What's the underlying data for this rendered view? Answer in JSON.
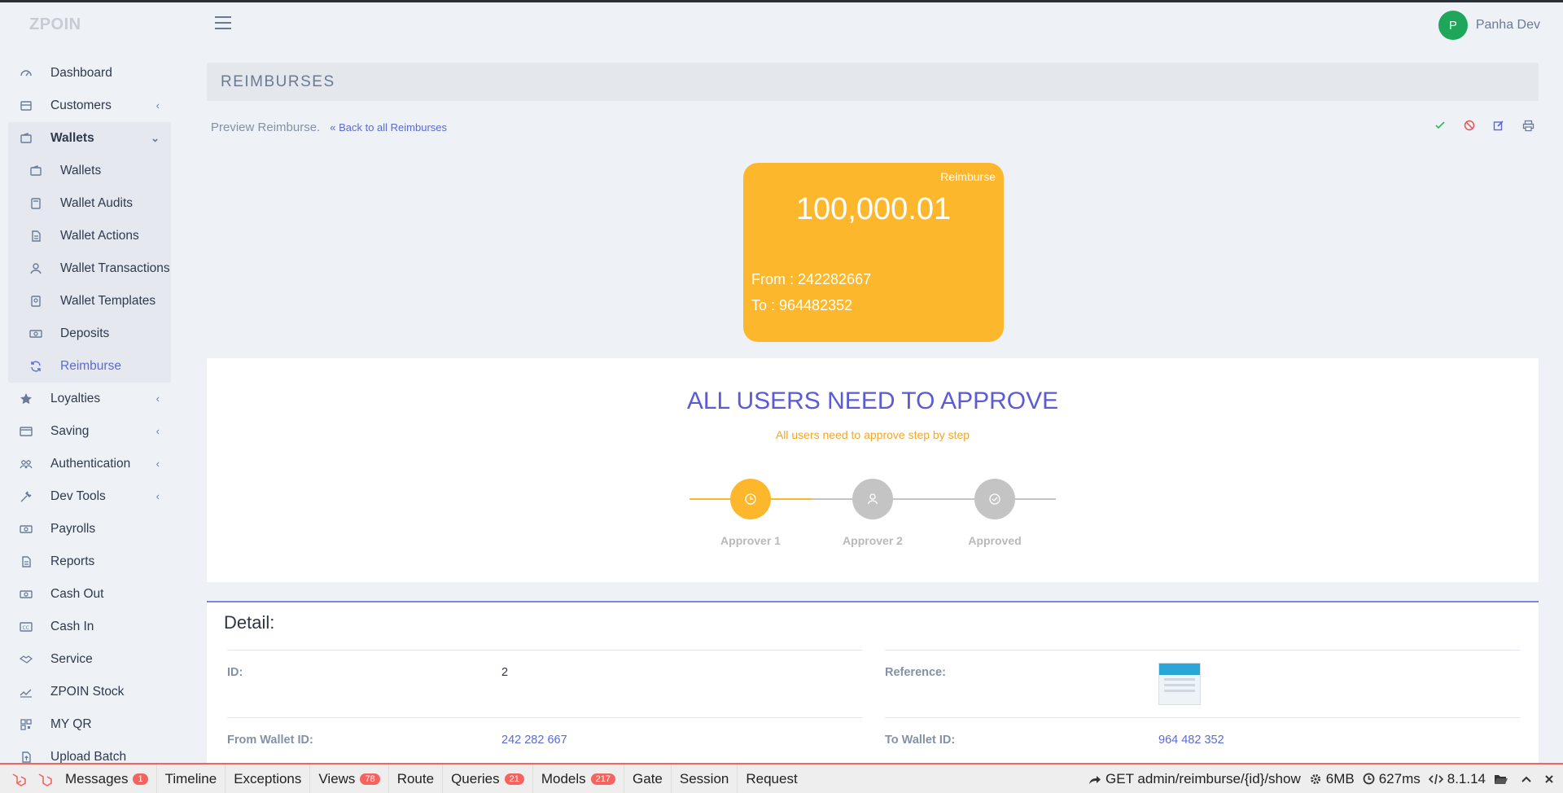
{
  "app": {
    "logo": "ZPOIN"
  },
  "header": {
    "user_initial": "P",
    "user_name": "Panha Dev"
  },
  "sidebar": {
    "items": [
      {
        "label": "Dashboard"
      },
      {
        "label": "Customers"
      },
      {
        "label": "Wallets"
      },
      {
        "label": "Loyalties"
      },
      {
        "label": "Saving"
      },
      {
        "label": "Authentication"
      },
      {
        "label": "Dev Tools"
      },
      {
        "label": "Payrolls"
      },
      {
        "label": "Reports"
      },
      {
        "label": "Cash Out"
      },
      {
        "label": "Cash In"
      },
      {
        "label": "Service"
      },
      {
        "label": "ZPOIN Stock"
      },
      {
        "label": "MY QR"
      },
      {
        "label": "Upload Batch"
      }
    ],
    "wallet_sub": [
      {
        "label": "Wallets"
      },
      {
        "label": "Wallet Audits"
      },
      {
        "label": "Wallet Actions"
      },
      {
        "label": "Wallet Transactions"
      },
      {
        "label": "Wallet Templates"
      },
      {
        "label": "Deposits"
      },
      {
        "label": "Reimburse"
      }
    ]
  },
  "page": {
    "title": "REIMBURSES",
    "subtitle": "Preview Reimburse.",
    "back_link": "Back to all Reimburses"
  },
  "card": {
    "badge": "Reimburse",
    "amount": "100,000.01",
    "from": "From : 242282667",
    "to": "To : 964482352"
  },
  "approval": {
    "heading": "ALL USERS NEED TO APPROVE",
    "subheading": "All users need to approve step by step",
    "steps": [
      {
        "label": "Approver 1"
      },
      {
        "label": "Approver 2"
      },
      {
        "label": "Approved"
      }
    ],
    "colors": {
      "active": "#fdb72c",
      "inactive": "#c4c4c4"
    }
  },
  "detail": {
    "title": "Detail:",
    "id_label": "ID:",
    "id_value": "2",
    "reference_label": "Reference:",
    "from_label": "From Wallet ID:",
    "from_value": "242 282 667",
    "to_label": "To Wallet ID:",
    "to_value": "964 482 352"
  },
  "debugbar": {
    "tabs": [
      {
        "label": "Messages",
        "count": "1"
      },
      {
        "label": "Timeline",
        "count": ""
      },
      {
        "label": "Exceptions",
        "count": ""
      },
      {
        "label": "Views",
        "count": "78"
      },
      {
        "label": "Route",
        "count": ""
      },
      {
        "label": "Queries",
        "count": "21"
      },
      {
        "label": "Models",
        "count": "217"
      },
      {
        "label": "Gate",
        "count": ""
      },
      {
        "label": "Session",
        "count": ""
      },
      {
        "label": "Request",
        "count": ""
      }
    ],
    "route": "GET admin/reimburse/{id}/show",
    "memory": "6MB",
    "time": "627ms",
    "php": "8.1.14"
  }
}
